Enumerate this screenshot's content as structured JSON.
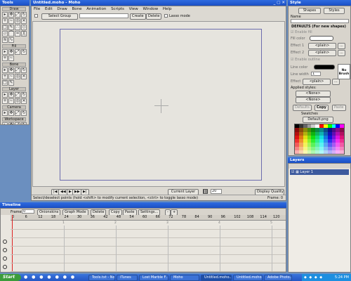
{
  "desktop_color": "#6b8fbf",
  "tools_panel": {
    "title": "Tools",
    "sections": [
      "Draw",
      "Fill",
      "Bone",
      "Layer",
      "Camera",
      "Workspace"
    ],
    "draw_tools": [
      "select-points",
      "translate-points",
      "scale-points",
      "rotate-points",
      "add-point",
      "curvature",
      "magnet",
      "delete-edge",
      "draw-shape",
      "freehand",
      "scatter-brush",
      "perspective",
      "shear",
      "bend",
      "noise",
      "hide-edge",
      "stroke-exposure",
      "curvature-alt"
    ],
    "fill_tools": [
      "select-shape",
      "create-shape",
      "paint-bucket",
      "delete-shape",
      "line-width",
      "hide-edge"
    ],
    "bone_tools": [
      "select-bone",
      "translate-bone",
      "scale-bone",
      "rotate-bone",
      "add-bone",
      "reparent-bone",
      "bone-strength",
      "manipulate-bones",
      "bind-layer",
      "bind-points"
    ],
    "layer_tools": [
      "set-origin",
      "translate-layer",
      "scale-layer",
      "rotate-layer-z",
      "rotate-layer-xy",
      "shear-layer",
      "switch-layer",
      "particle-layer"
    ],
    "camera_tools": [
      "track-camera",
      "zoom-camera",
      "roll-camera",
      "pan-tilt-camera"
    ],
    "workspace_tools": [
      "pan",
      "zoom",
      "rotate-workspace",
      "orbit-workspace"
    ]
  },
  "main_window": {
    "title": "Untitled.moho - Moho",
    "menu": [
      "File",
      "Edit",
      "Draw",
      "Bone",
      "Animation",
      "Scripts",
      "View",
      "Window",
      "Help"
    ],
    "toolbar": {
      "group_select": "Select Group",
      "group_name_value": "",
      "create_label": "Create",
      "delete_label": "Delete",
      "lasso_label": "Lasso mode"
    },
    "status_bar": {
      "layer_select": "Current Layer",
      "zoom_value": "20",
      "display_select": "Display Quality",
      "hint": "Select/deselect points (hold <shift> to modify current selection, <ctrl> to toggle lasso mode)",
      "frame_label": "Frame: 0"
    }
  },
  "style_panel": {
    "title": "Style",
    "tabs": [
      "Shapes",
      "Styles"
    ],
    "name_label": "Name",
    "defaults_heading": "DEFAULTS (For new shapes)",
    "enable_fill": "Enable fill",
    "fill_color_label": "Fill color",
    "effect1_label": "Effect 1",
    "effect1_value": "<plain>",
    "effect2_label": "Effect 2",
    "effect2_value": "<plain>",
    "enable_outline": "Enable outline",
    "line_color_label": "Line color",
    "line_width_label": "Line width",
    "line_width_value": "1",
    "effect_label": "Effect",
    "effect_value": "<plain>",
    "brush_label": "No Brush",
    "applied_styles_label": "Applied styles:",
    "applied_style_1": "<None>",
    "applied_style_2": "<None>",
    "defaults_btn": "Defaults",
    "copy_btn": "Copy",
    "paste_btn": "Paste",
    "swatches_label": "Swatches",
    "swatches_select": "Default.png",
    "fill_color": "#ffffff",
    "line_color": "#000000"
  },
  "layers_panel": {
    "title": "Layers",
    "layers": [
      {
        "name": "Layer 1",
        "visible": true
      }
    ]
  },
  "timeline": {
    "title": "Timeline",
    "frame_label": "Frame",
    "frame_value": "0",
    "onionskins_label": "Onionskins",
    "graph_mode_label": "Graph Mode",
    "delete_label": "Delete",
    "copy_label": "Copy",
    "paste_label": "Paste",
    "settings_label": "Settings...",
    "ruler_ticks": [
      "0",
      "6",
      "12",
      "18",
      "24",
      "30",
      "36",
      "42",
      "48",
      "54",
      "60",
      "66",
      "72",
      "78",
      "84",
      "90",
      "96",
      "102",
      "108",
      "114",
      "120"
    ],
    "row_ticks": [
      "1",
      "2",
      "3",
      "4",
      "5"
    ]
  },
  "taskbar": {
    "start_label": "Start",
    "tasks": [
      "Tools.txt - Note...",
      "iTunes",
      "Lost Marble F...",
      "Untitled.moho...",
      "Untitled.moho...",
      "Adobe Photo...",
      "Moho"
    ],
    "clock": "5:24 PM"
  }
}
